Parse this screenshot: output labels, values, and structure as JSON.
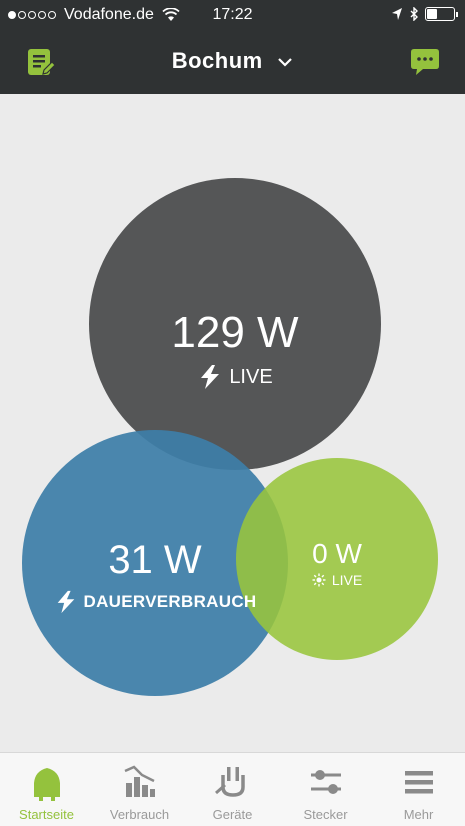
{
  "status_bar": {
    "carrier": "Vodafone.de",
    "time": "17:22"
  },
  "header": {
    "title": "Bochum",
    "left_icon": "document-edit-icon",
    "right_icon": "chat-bubble-icon"
  },
  "bubbles": {
    "live": {
      "value": "129 W",
      "label": "LIVE",
      "icon": "lightning-icon",
      "color": "#4f5152"
    },
    "standby": {
      "value": "31 W",
      "label": "DAUERVERBRAUCH",
      "icon": "lightning-icon",
      "color": "#3d7ea8"
    },
    "solar": {
      "value": "0 W",
      "label": "LIVE",
      "icon": "sun-icon",
      "color": "#98c53c"
    }
  },
  "tabs": [
    {
      "label": "Startseite",
      "icon": "house-icon",
      "active": true
    },
    {
      "label": "Verbrauch",
      "icon": "bar-chart-icon",
      "active": false
    },
    {
      "label": "Geräte",
      "icon": "plug-icon",
      "active": false
    },
    {
      "label": "Stecker",
      "icon": "sliders-icon",
      "active": false
    },
    {
      "label": "Mehr",
      "icon": "menu-icon",
      "active": false
    }
  ],
  "colors": {
    "accent": "#94c23d",
    "header_bg": "#2f3233",
    "background": "#ebebeb"
  }
}
